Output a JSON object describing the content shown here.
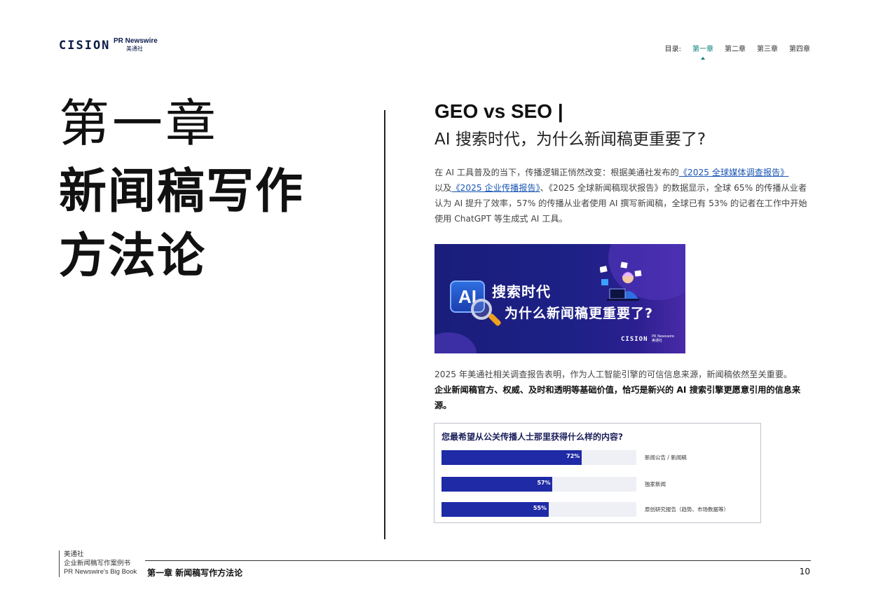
{
  "header": {
    "logo_cision": "CISION",
    "logo_prn_en": "PR Newswire",
    "logo_prn_zh": "美通社",
    "toc_label": "目录:",
    "toc_items": [
      "第一章",
      "第二章",
      "第三章",
      "第四章"
    ],
    "toc_active_index": 0
  },
  "chapter": {
    "line1": "第一章",
    "line2": "新闻稿写作",
    "line3": "方法论"
  },
  "article": {
    "title": "GEO vs SEO |",
    "subtitle": "AI 搜索时代，为什么新闻稿更重要了?",
    "para1_a": "在 AI 工具普及的当下，传播逻辑正悄然改变：根据美通社发布的",
    "para1_link1": "《2025 全球媒体调查报告》",
    "para1_b": "以及",
    "para1_link2": "《2025 企业传播报告》",
    "para1_c": "、《2025 全球新闻稿现状报告》的数据显示，全球 65% 的传播从业者认为 AI 提升了效率，57% 的传播从业者使用 AI 撰写新闻稿，全球已有 53% 的记者在工作中开始使用 ChatGPT 等生成式 AI 工具。",
    "para2_plain": "2025 年美通社相关调查报告表明，作为人工智能引擎的可信信息来源，新闻稿依然至关重要。",
    "para2_bold": "企业新闻稿官方、权威、及时和透明等基础价值，恰巧是新兴的 AI 搜索引擎更愿意引用的信息来源。"
  },
  "banner": {
    "ai_text": "AI",
    "line1": "搜索时代",
    "line2": "为什么新闻稿更重要了?",
    "cision": "CISION",
    "prn_en": "PR Newswire",
    "prn_zh": "美通社"
  },
  "survey": {
    "question": "您最希望从公关传播人士那里获得什么样的内容?",
    "bar_color": "#1f2aa6",
    "rows": [
      {
        "value": 72,
        "label_pct": "72%",
        "label": "新闻公告 / 新闻稿"
      },
      {
        "value": 57,
        "label_pct": "57%",
        "label": "独家新闻"
      },
      {
        "value": 55,
        "label_pct": "55%",
        "label": "原创研究报告（趋势、市场数据等）"
      }
    ]
  },
  "footer": {
    "brand_zh": "美通社",
    "book_zh": "企业新闻稿写作案例书",
    "book_en": "PR Newswire's Big Book",
    "chapter_title": "第一章 新闻稿写作方法论",
    "page_number": "10"
  }
}
